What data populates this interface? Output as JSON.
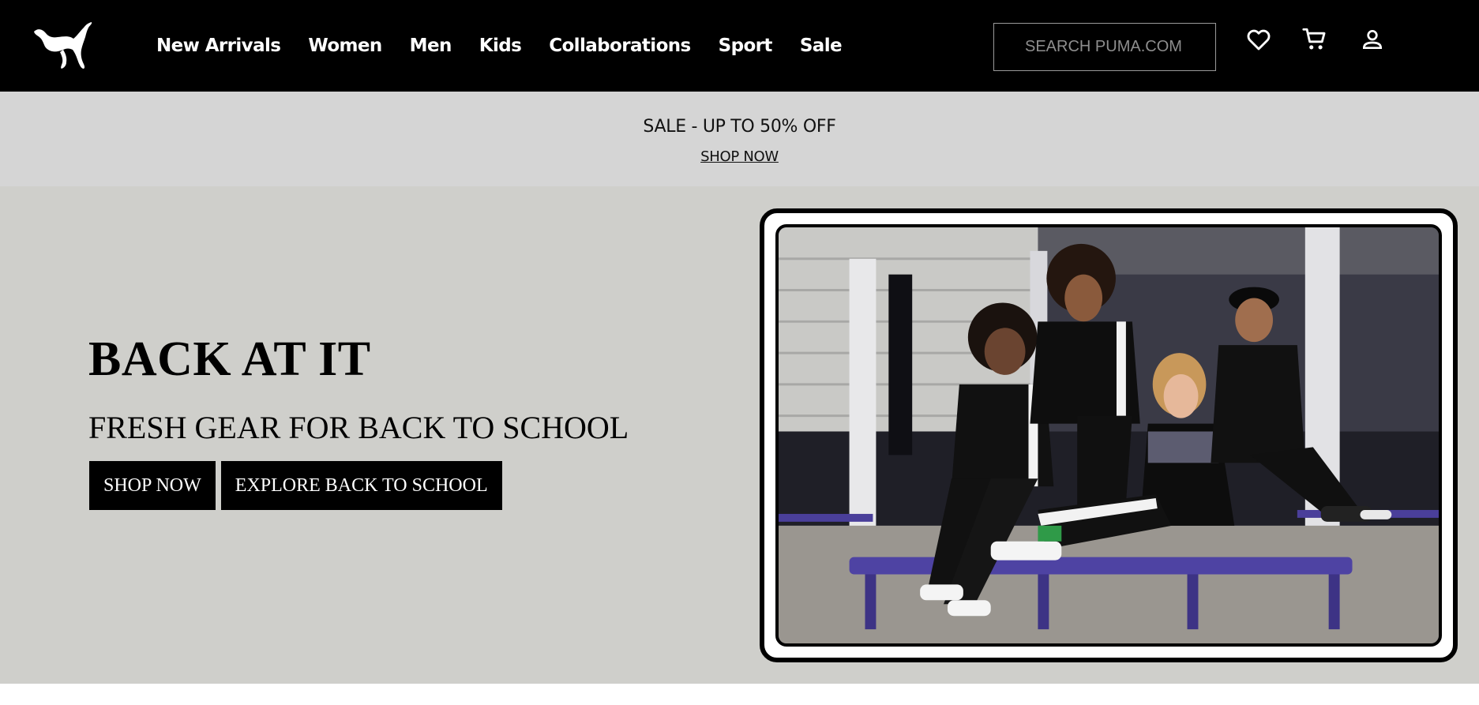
{
  "header": {
    "logo_icon": "puma-logo-icon",
    "nav": [
      {
        "label": "New Arrivals"
      },
      {
        "label": "Women"
      },
      {
        "label": "Men"
      },
      {
        "label": "Kids"
      },
      {
        "label": "Collaborations"
      },
      {
        "label": "Sport"
      },
      {
        "label": "Sale"
      }
    ],
    "search_placeholder": "SEARCH PUMA.COM",
    "icons": [
      "heart-icon",
      "cart-icon",
      "user-icon"
    ]
  },
  "promo": {
    "title": "SALE - UP TO 50% OFF",
    "link": "SHOP NOW"
  },
  "hero": {
    "title": "BACK AT IT",
    "subtitle": "FRESH GEAR FOR BACK TO SCHOOL",
    "buttons": [
      {
        "label": "SHOP NOW"
      },
      {
        "label": "EXPLORE BACK TO SCHOOL"
      }
    ]
  },
  "colors": {
    "header_bg": "#000000",
    "promo_bg": "#d5d5d5",
    "hero_bg": "#cfcfcb",
    "button_bg": "#000000",
    "button_text": "#ffffff"
  }
}
